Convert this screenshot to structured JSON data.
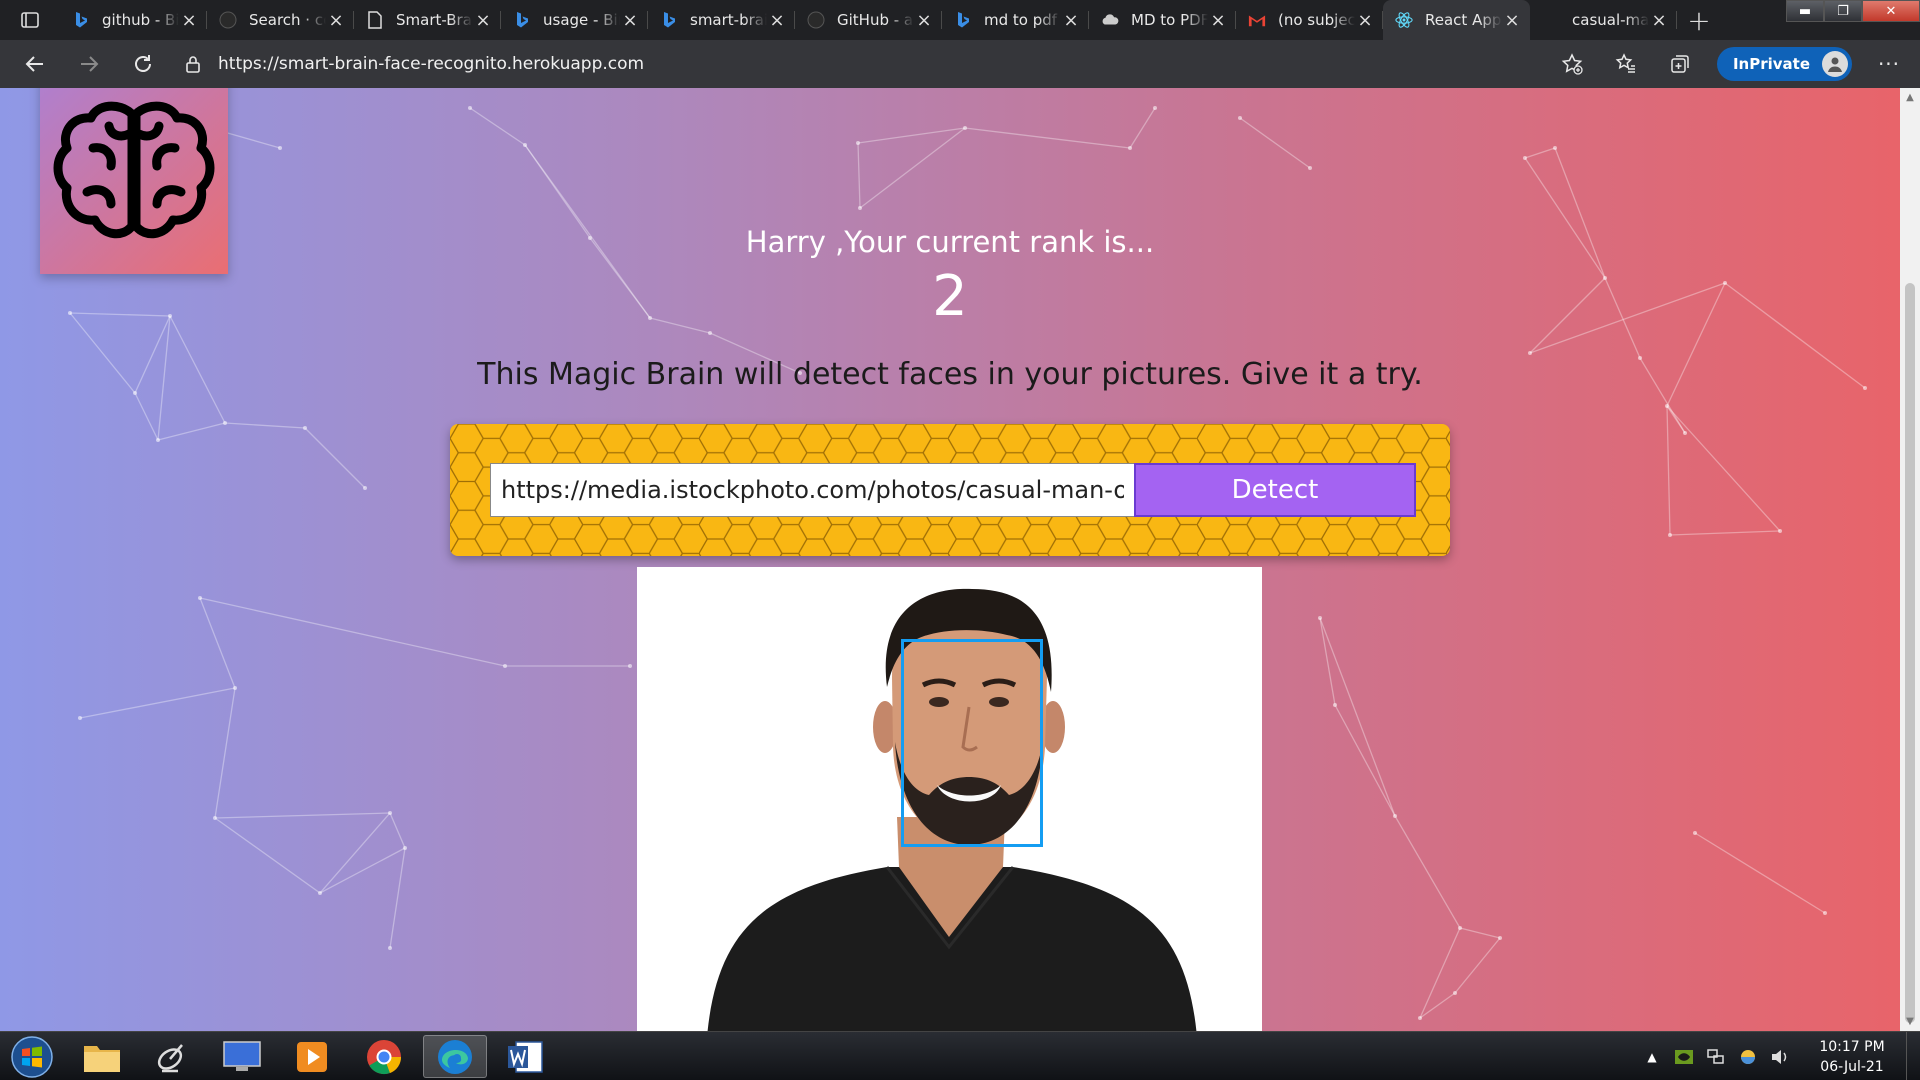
{
  "browser": {
    "tabs": [
      {
        "title": "github - Bing",
        "icon": "bing-icon",
        "active": false
      },
      {
        "title": "Search · code",
        "icon": "github-icon",
        "active": false
      },
      {
        "title": "Smart-Brain",
        "icon": "document-icon",
        "active": false
      },
      {
        "title": "usage - Bing",
        "icon": "bing-icon",
        "active": false
      },
      {
        "title": "smart-brain",
        "icon": "bing-icon",
        "active": false
      },
      {
        "title": "GitHub - a",
        "icon": "github-icon",
        "active": false
      },
      {
        "title": "md to pdf",
        "icon": "bing-icon",
        "active": false
      },
      {
        "title": "MD to PDF",
        "icon": "cloud-icon",
        "active": false
      },
      {
        "title": "(no subject)",
        "icon": "gmail-icon",
        "active": false
      },
      {
        "title": "React App",
        "icon": "react-icon",
        "active": true
      },
      {
        "title": "casual-man",
        "icon": "",
        "active": false
      }
    ],
    "address": "https://smart-brain-face-recognito.herokuapp.com",
    "inprivate_label": "InPrivate"
  },
  "page": {
    "rank_text": "Harry ,Your current rank is...",
    "rank_number": "2",
    "intro": "This Magic Brain will detect faces in your pictures. Give it a try.",
    "url_value": "https://media.istockphoto.com/photos/casual-man-on-white-background-picture-id",
    "detect_label": "Detect"
  },
  "taskbar": {
    "time": "10:17 PM",
    "date": "06-Jul-21"
  },
  "colors": {
    "gradient_left": "#8f98e6",
    "gradient_right": "#e8646a",
    "form_yellow": "#f9b713",
    "detect_purple": "#a463f2",
    "box_blue": "#149df2"
  }
}
